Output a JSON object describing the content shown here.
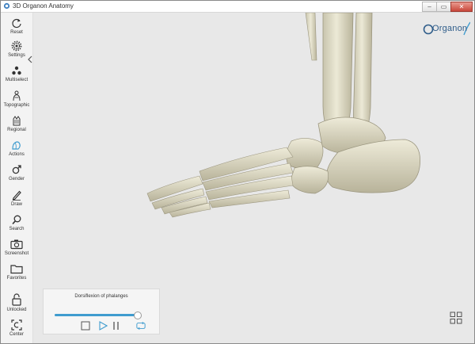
{
  "window": {
    "title": "3D Organon Anatomy",
    "controls": [
      "minimize",
      "restore",
      "close"
    ]
  },
  "sidebar": {
    "items": [
      {
        "label": "Reset",
        "icon": "reset-icon"
      },
      {
        "label": "Settings",
        "icon": "gear-icon"
      },
      {
        "label": "Multiselect",
        "icon": "multiselect-icon"
      },
      {
        "label": "Topographic",
        "icon": "topographic-icon"
      },
      {
        "label": "Regional",
        "icon": "regional-icon"
      },
      {
        "label": "Actions",
        "icon": "actions-icon"
      },
      {
        "label": "Gender",
        "icon": "male-icon"
      },
      {
        "label": "Draw",
        "icon": "pencil-icon"
      },
      {
        "label": "Search",
        "icon": "search-icon"
      },
      {
        "label": "Screenshot",
        "icon": "camera-icon"
      },
      {
        "label": "Favorites",
        "icon": "folder-icon"
      },
      {
        "label": "Unlocked",
        "icon": "unlock-icon"
      },
      {
        "label": "Center",
        "icon": "center-icon"
      }
    ]
  },
  "logo": {
    "text": "Organon"
  },
  "animation": {
    "title": "Dorsiflexion of phalanges",
    "progress": 0.96,
    "accent_color": "#3f9ccf"
  }
}
